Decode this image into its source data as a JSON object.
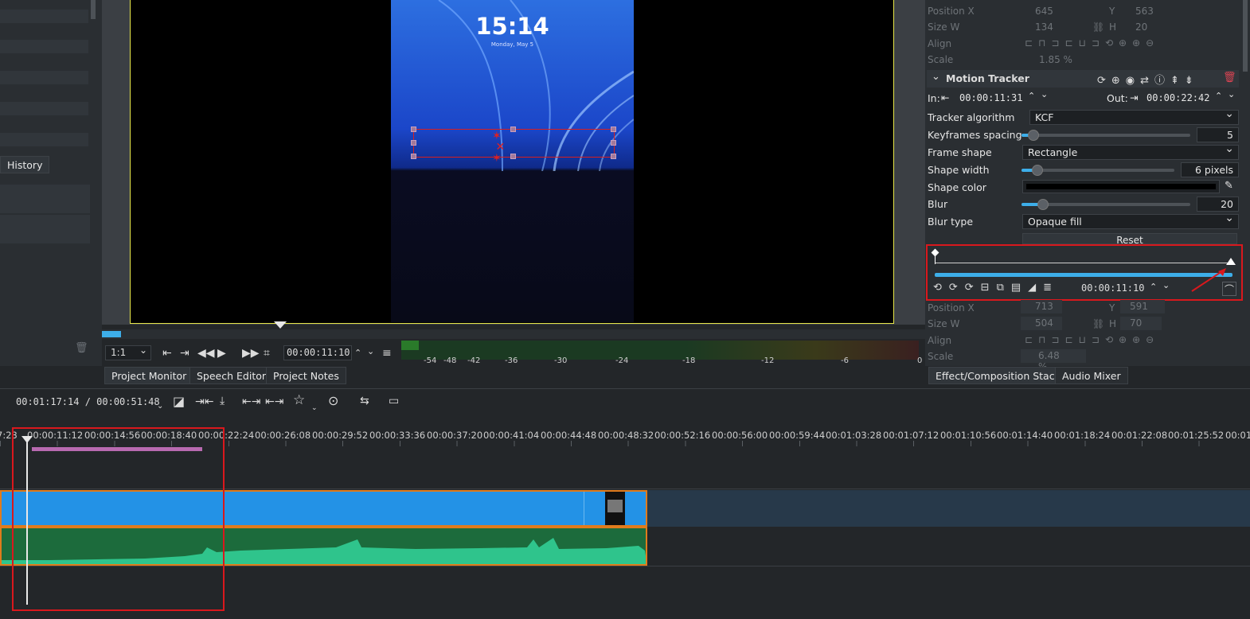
{
  "left_panel": {
    "tab_history": "History"
  },
  "monitor": {
    "clock": "15:14",
    "date": "Monday, May 5",
    "zoom_select": "1:1",
    "timecode": "00:00:11:10",
    "audio_scale": [
      "-54",
      "-48",
      "-42",
      "-36",
      "-30",
      "-24",
      "-18",
      "-12",
      "-6",
      "0"
    ]
  },
  "monitor_tabs": [
    "Project Monitor",
    "Speech Editor",
    "Project Notes"
  ],
  "effect_panel": {
    "transform_top": {
      "pos_label": "Position X",
      "pos_x": "645",
      "y_label": "Y",
      "pos_y": "563",
      "size_label": "Size W",
      "size_w": "134",
      "h_label": "H",
      "size_h": "20",
      "align_label": "Align",
      "scale_label": "Scale",
      "scale": "1.85 %"
    },
    "motion_tracker": {
      "title": "Motion Tracker",
      "in_label": "In:",
      "in_time": "00:00:11:31",
      "out_label": "Out:",
      "out_time": "00:00:22:42",
      "params": [
        {
          "label": "Tracker algorithm",
          "value": "KCF"
        },
        {
          "label": "Keyframes spacing",
          "value": "5"
        },
        {
          "label": "Frame shape",
          "value": "Rectangle"
        },
        {
          "label": "Shape width",
          "value": "6 pixels"
        },
        {
          "label": "Shape color",
          "value": ""
        },
        {
          "label": "Blur",
          "value": "20"
        },
        {
          "label": "Blur type",
          "value": "Opaque fill"
        }
      ],
      "reset_label": "Reset",
      "keyframe_time": "00:00:11:10"
    },
    "transform_bottom": {
      "pos_label": "Position X",
      "pos_x": "713",
      "y_label": "Y",
      "pos_y": "591",
      "size_label": "Size W",
      "size_w": "504",
      "h_label": "H",
      "size_h": "70",
      "align_label": "Align",
      "scale_label": "Scale",
      "scale": "6.48 %"
    }
  },
  "effect_tabs": [
    "Effect/Composition Stack",
    "Audio Mixer"
  ],
  "timeline": {
    "position": "00:01:17:14 / 00:00:51:48",
    "ruler": [
      "7:23",
      "00:00:11:12",
      "00:00:14:56",
      "00:00:18:40",
      "00:00:22:24",
      "00:00:26:08",
      "00:00:29:52",
      "00:00:33:36",
      "00:00:37:20",
      "00:00:41:04",
      "00:00:44:48",
      "00:00:48:32",
      "00:00:52:16",
      "00:00:56:00",
      "00:00:59:44",
      "00:01:03:28",
      "00:01:07:12",
      "00:01:10:56",
      "00:01:14:40",
      "00:01:18:24",
      "00:01:22:08",
      "00:01:25:52",
      "00:01:"
    ]
  }
}
